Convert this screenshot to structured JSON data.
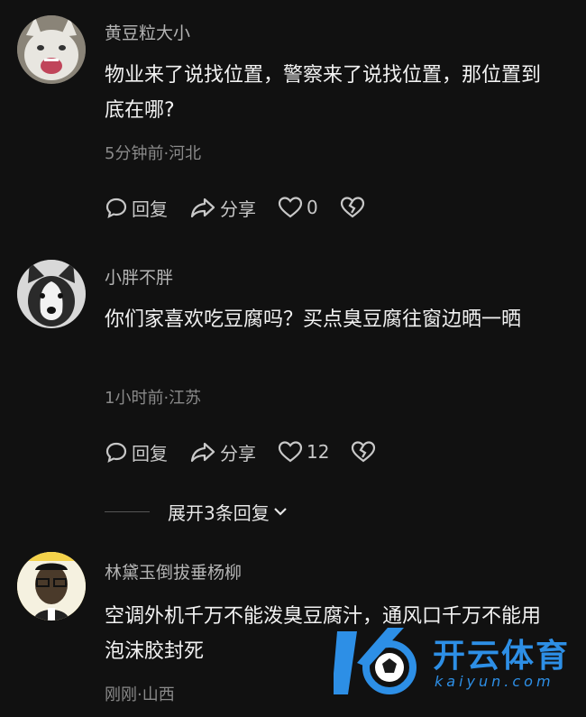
{
  "comments": [
    {
      "username": "黄豆粒大小",
      "avatar": "white-cat-avatar",
      "content": "物业来了说找位置，警察来了说找位置，那位置到底在哪?",
      "meta": "5分钟前·河北",
      "reply_label": "回复",
      "share_label": "分享",
      "like_count": "0"
    },
    {
      "username": "小胖不胖",
      "avatar": "husky-dog-avatar",
      "content": "你们家喜欢吃豆腐吗？买点臭豆腐往窗边晒一晒",
      "meta": "1小时前·江苏",
      "reply_label": "回复",
      "share_label": "分享",
      "like_count": "12"
    },
    {
      "username": "林黛玉倒拔垂杨柳",
      "avatar": "cartoon-person-avatar",
      "content": "空调外机千万不能泼臭豆腐汁，通风口千万不能用泡沫胶封死",
      "meta": "刚刚·山西"
    }
  ],
  "expand_replies": "展开3条回复",
  "watermark": {
    "cn": "开云体育",
    "en": "kaiyun.com"
  },
  "colors": {
    "background": "#111111",
    "watermark_blue": "#2d8fe6"
  }
}
